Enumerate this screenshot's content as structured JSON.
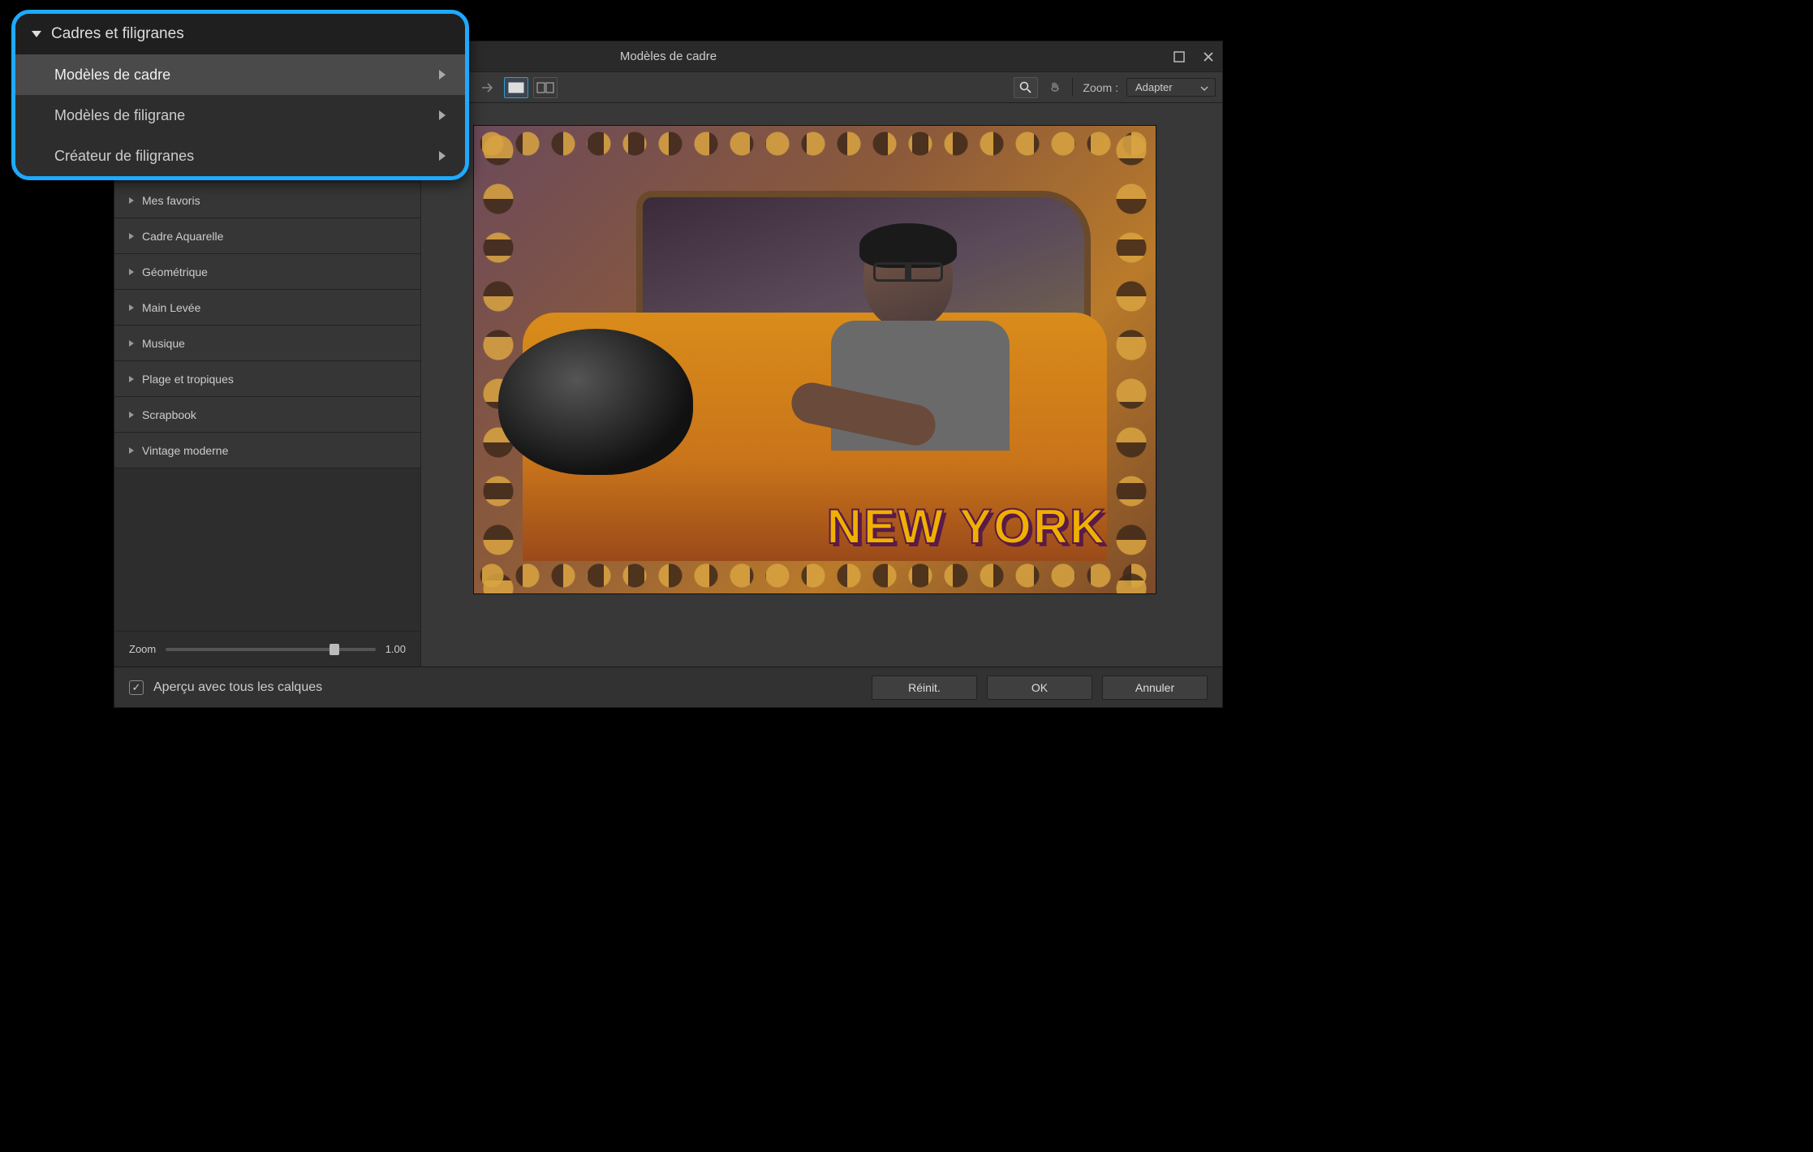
{
  "dialog": {
    "title": "Modèles de cadre"
  },
  "toolbar": {
    "zoom_label": "Zoom :",
    "zoom_value": "Adapter"
  },
  "overlay_menu": {
    "header": "Cadres et filigranes",
    "items": [
      {
        "label": "Modèles de cadre",
        "selected": true
      },
      {
        "label": "Modèles de filigrane",
        "selected": false
      },
      {
        "label": "Créateur de filigranes",
        "selected": false
      }
    ]
  },
  "categories": [
    "Mes favoris",
    "Cadre Aquarelle",
    "Géométrique",
    "Main Levée",
    "Musique",
    "Plage et tropiques",
    "Scrapbook",
    "Vintage moderne"
  ],
  "side_zoom": {
    "label": "Zoom",
    "value": "1.00"
  },
  "preview": {
    "overlay_text": "NEW YORK"
  },
  "footer": {
    "checkbox_label": "Aperçu avec tous les calques",
    "buttons": {
      "reset": "Réinit.",
      "ok": "OK",
      "cancel": "Annuler"
    }
  }
}
